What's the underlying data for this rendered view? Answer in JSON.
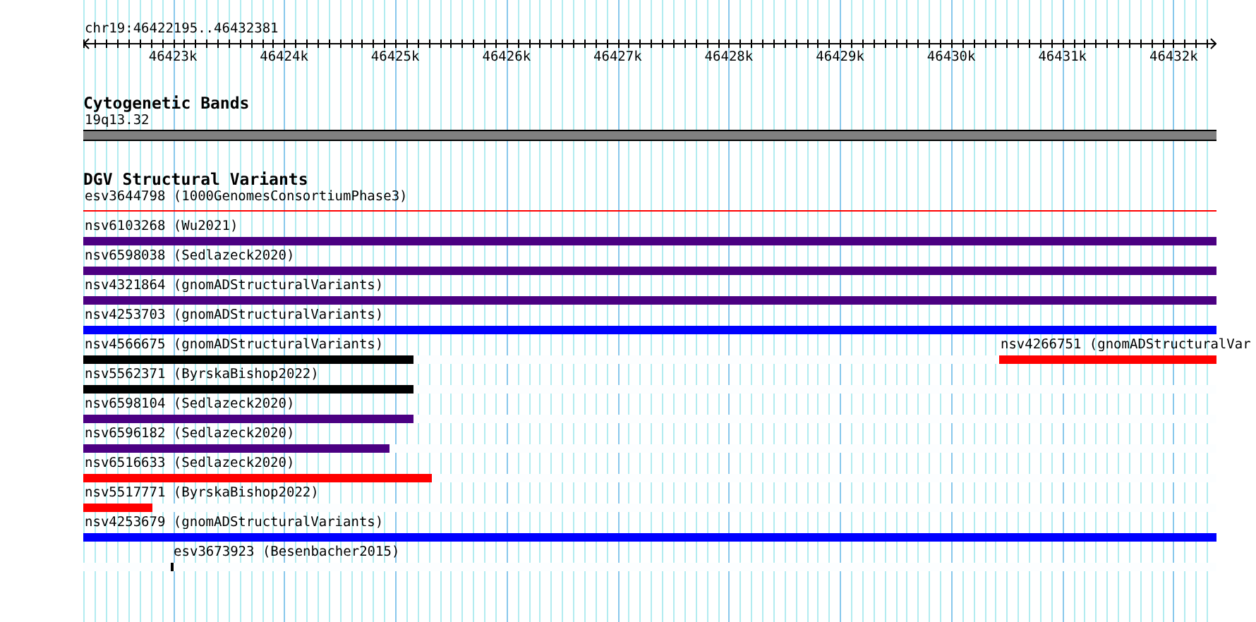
{
  "ruler": {
    "locus": "chr19:46422195..46432381",
    "ticks": [
      {
        "label": "46423k",
        "level": 0.0791
      },
      {
        "label": "46424k",
        "level": 0.1772
      },
      {
        "label": "46425k",
        "level": 0.2753
      },
      {
        "label": "46426k",
        "level": 0.3735
      },
      {
        "label": "46427k",
        "level": 0.4716
      },
      {
        "label": "46428k",
        "level": 0.5697
      },
      {
        "label": "46429k",
        "level": 0.6679
      },
      {
        "label": "46430k",
        "level": 0.766
      },
      {
        "label": "46431k",
        "level": 0.8641
      },
      {
        "label": "46432k",
        "level": 0.9622
      }
    ]
  },
  "tracks": [
    {
      "kind": "bands",
      "title": "Cytogenetic Bands",
      "bands": [
        {
          "label": "19q13.32"
        }
      ]
    },
    {
      "kind": "features",
      "title": "DGV Structural Variants",
      "lanes": [
        {
          "features": [
            {
              "label": "esv3644798 (1000GenomesConsortiumPhase3)",
              "kind": "line",
              "level": 1,
              "color": "#ff0000"
            }
          ]
        },
        {
          "features": [
            {
              "label": "nsv6103268 (Wu2021)",
              "kind": "left",
              "level": 1,
              "color": "#4b0082"
            }
          ]
        },
        {
          "features": [
            {
              "label": "nsv6598038 (Sedlazeck2020)",
              "kind": "left",
              "level": 1,
              "color": "#4b0082"
            }
          ]
        },
        {
          "features": [
            {
              "label": "nsv4321864 (gnomADStructuralVariants)",
              "kind": "left",
              "level": 1,
              "color": "#4b0082"
            }
          ]
        },
        {
          "features": [
            {
              "label": "nsv4253703 (gnomADStructuralVariants)",
              "kind": "left",
              "level": 1,
              "color": "#0000ff"
            }
          ]
        },
        {
          "features": [
            {
              "label": "nsv4566675 (gnomADStructuralVariants)",
              "kind": "left",
              "level": 0.2914,
              "color": "#000000"
            },
            {
              "label": "nsv4266751 (gnomADStructuralVar",
              "kind": "right",
              "level": 0.1918,
              "color": "#ff0000"
            }
          ]
        },
        {
          "features": [
            {
              "label": "nsv5562371 (ByrskaBishop2022)",
              "kind": "left",
              "level": 0.2914,
              "color": "#000000"
            }
          ]
        },
        {
          "features": [
            {
              "label": "nsv6598104 (Sedlazeck2020)",
              "kind": "left",
              "level": 0.2914,
              "color": "#4b0082"
            }
          ]
        },
        {
          "features": [
            {
              "label": "nsv6596182 (Sedlazeck2020)",
              "kind": "left",
              "level": 0.2702,
              "color": "#4b0082"
            }
          ]
        },
        {
          "features": [
            {
              "label": "nsv6516633 (Sedlazeck2020)",
              "kind": "left",
              "level": 0.3076,
              "color": "#ff0000"
            }
          ]
        },
        {
          "features": [
            {
              "label": "nsv5517771 (ByrskaBishop2022)",
              "kind": "left",
              "level": 0.061,
              "color": "#ff0000"
            }
          ]
        },
        {
          "features": [
            {
              "label": "nsv4253679 (gnomADStructuralVariants)",
              "kind": "left",
              "level": 1,
              "color": "#0000ff"
            }
          ]
        },
        {
          "features": [
            {
              "label": "esv3673923 (Besenbacher2015)",
              "kind": "point",
              "level": 0.0785,
              "color": "#000000"
            }
          ]
        }
      ]
    }
  ]
}
